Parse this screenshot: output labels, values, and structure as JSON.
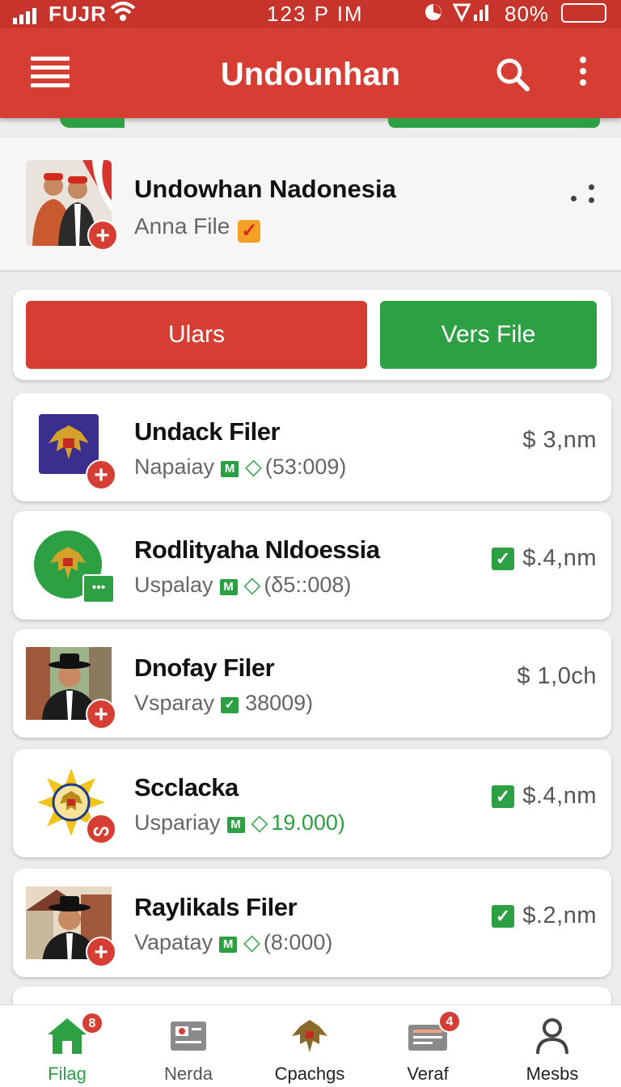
{
  "status_bar": {
    "carrier": "FUJR",
    "time": "123 P IM",
    "battery_pct": "80%",
    "battery_level": 0.95
  },
  "app_bar": {
    "title": "Undounhan"
  },
  "profile": {
    "name": "Undowhan Nadonesia",
    "subtitle": "Anna File"
  },
  "actions": {
    "primary_label": "Ulars",
    "secondary_label": "Vers File"
  },
  "items": [
    {
      "title": "Undack Filer",
      "meta_label": "Napaiay",
      "meta_value": "(53:009)",
      "price": "$ 3,nm",
      "verified": false,
      "meta_green": false
    },
    {
      "title": "Rodlityaha Nldoessia",
      "meta_label": "Uspalay",
      "meta_value": "(δ5::008)",
      "price": "$.4,nm",
      "verified": true,
      "meta_green": false
    },
    {
      "title": "Dnofay Filer",
      "meta_label": "Vsparay",
      "meta_value": "38009)",
      "price": "$ 1,0ch",
      "verified": false,
      "meta_green": false
    },
    {
      "title": "Scclacka",
      "meta_label": "Uspariay",
      "meta_value": "19.000)",
      "price": "$.4,nm",
      "verified": true,
      "meta_green": true
    },
    {
      "title": "Raylikals Filer",
      "meta_label": "Vapatay",
      "meta_value": "(8:000)",
      "price": "$.2,nm",
      "verified": true,
      "meta_green": false
    }
  ],
  "bottom_nav": [
    {
      "label": "Filag",
      "badge": "8",
      "active": true
    },
    {
      "label": "Nerda",
      "badge": "",
      "active": false
    },
    {
      "label": "Cpachgs",
      "badge": "",
      "active": false
    },
    {
      "label": "Veraf",
      "badge": "4",
      "active": false
    },
    {
      "label": "Mesbs",
      "badge": "",
      "active": false
    }
  ],
  "colors": {
    "primary_red": "#d63e34",
    "primary_green": "#2ca043",
    "background": "#ececec"
  }
}
